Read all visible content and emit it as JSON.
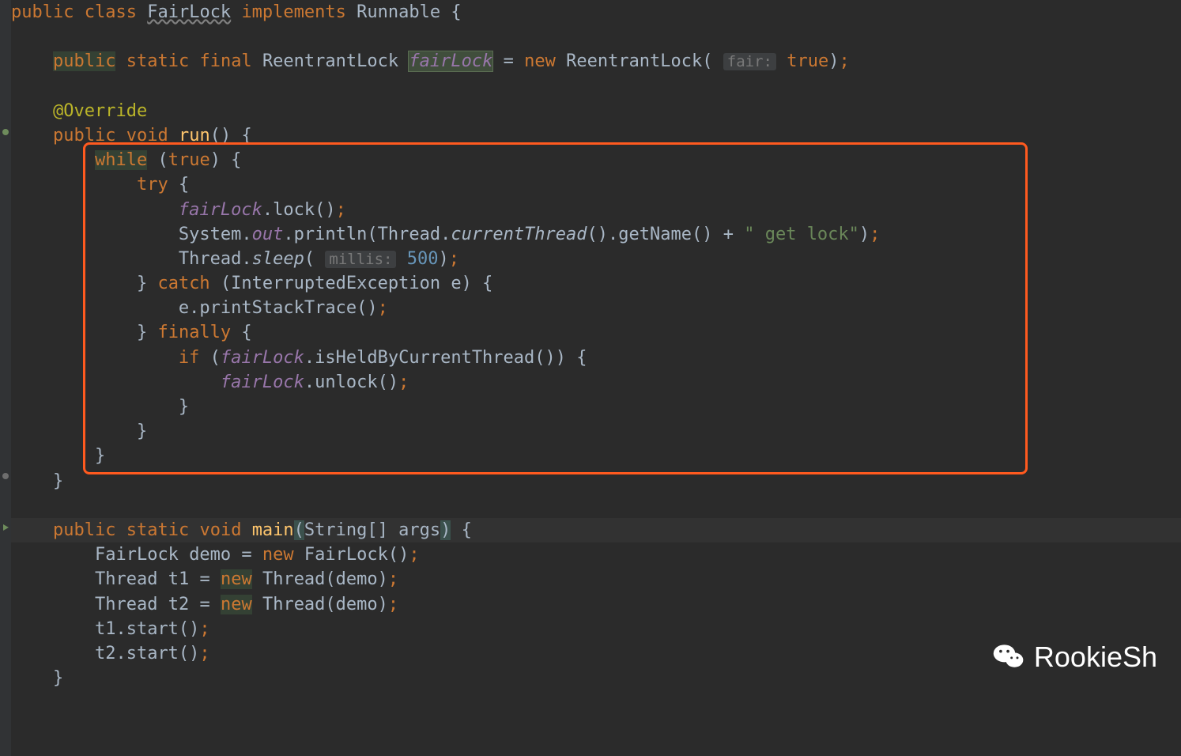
{
  "code": {
    "line1": {
      "kw_public": "public",
      "kw_class": "class",
      "classname": "FairLock",
      "kw_implements": "implements",
      "interface": "Runnable",
      "brace": "{"
    },
    "line3": {
      "kw_public": "public",
      "kw_static": "static",
      "kw_final": "final",
      "type": "ReentrantLock",
      "field": "fairLock",
      "eq": "=",
      "kw_new": "new",
      "ctor": "ReentrantLock",
      "hint": "fair:",
      "val": "true",
      "close": ");"
    },
    "line5": {
      "annotation": "@Override"
    },
    "line6": {
      "kw_public": "public",
      "kw_void": "void",
      "method": "run",
      "parens": "()",
      "brace": "{"
    },
    "line7": {
      "kw_while": "while",
      "cond": "(",
      "val": "true",
      "close": ") {"
    },
    "line8": {
      "kw_try": "try",
      "brace": "{"
    },
    "line9": {
      "field": "fairLock",
      "dot": ".",
      "method": "lock()",
      "semi": ";"
    },
    "line10": {
      "sys": "System",
      "dot1": ".",
      "out": "out",
      "dot2": ".",
      "println": "println(Thread.",
      "currentThread": "currentThread",
      "afterCT": "().getName() + ",
      "string": "\" get lock\"",
      "close": ");"
    },
    "line11": {
      "thread": "Thread",
      "dot": ".",
      "sleep": "sleep",
      "open": "(",
      "hint": "millis:",
      "val": "500",
      "close": ");"
    },
    "line12": {
      "brace": "}",
      "kw_catch": "catch",
      "params": "(InterruptedException e) {"
    },
    "line13": {
      "call": "e.printStackTrace()",
      "semi": ";"
    },
    "line14": {
      "brace": "}",
      "kw_finally": "finally",
      "open": "{"
    },
    "line15": {
      "kw_if": "if",
      "open": "(",
      "field": "fairLock",
      "rest": ".isHeldByCurrentThread()) {"
    },
    "line16": {
      "field": "fairLock",
      "rest": ".unlock()",
      "semi": ";"
    },
    "line17": {
      "brace": "}"
    },
    "line18": {
      "brace": "}"
    },
    "line19": {
      "brace": "}"
    },
    "line20": {
      "brace": "}"
    },
    "line22": {
      "kw_public": "public",
      "kw_static": "static",
      "kw_void": "void",
      "method": "main",
      "open": "(",
      "params": "String[] args",
      "close": ")",
      "brace": " {"
    },
    "line23": {
      "type": "FairLock",
      "var": "demo",
      "eq": "=",
      "kw_new": "new",
      "ctor": "FairLock()",
      "semi": ";"
    },
    "line24": {
      "type": "Thread",
      "var": "t1",
      "eq": "=",
      "kw_new": "new",
      "ctor": "Thread(demo)",
      "semi": ";"
    },
    "line25": {
      "type": "Thread",
      "var": "t2",
      "eq": "=",
      "kw_new": "new",
      "ctor": "Thread(demo)",
      "semi": ";"
    },
    "line26": {
      "call": "t1.start()",
      "semi": ";"
    },
    "line27": {
      "call": "t2.start()",
      "semi": ";"
    },
    "line28": {
      "brace": "}"
    }
  },
  "watermark": {
    "text": "RookieSh"
  }
}
